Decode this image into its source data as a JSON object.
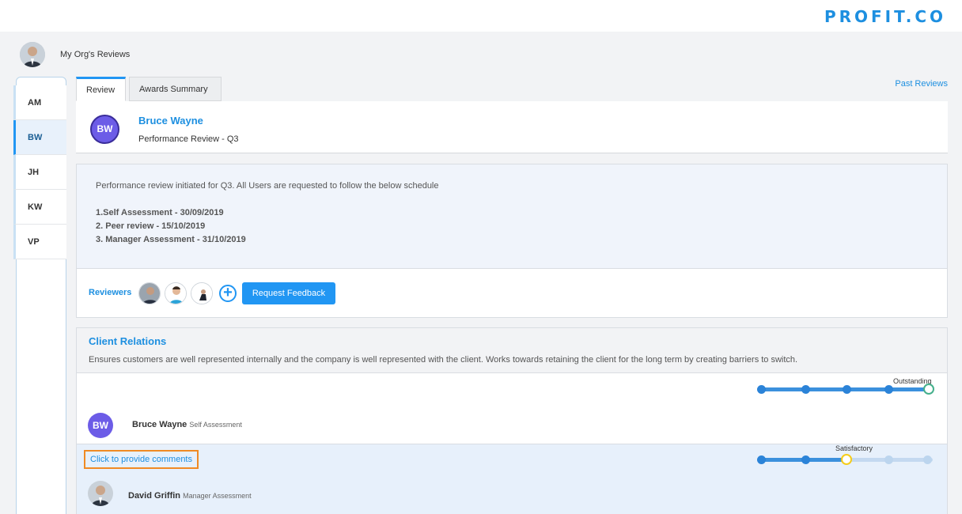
{
  "brand": {
    "name": "PROFIT.CO"
  },
  "org": {
    "title": "My Org's Reviews"
  },
  "sidebar": {
    "items": [
      {
        "label": "AM",
        "active": false
      },
      {
        "label": "BW",
        "active": true
      },
      {
        "label": "JH",
        "active": false
      },
      {
        "label": "KW",
        "active": false
      },
      {
        "label": "VP",
        "active": false
      }
    ]
  },
  "tabs": [
    {
      "label": "Review",
      "active": true
    },
    {
      "label": "Awards Summary",
      "active": false
    }
  ],
  "past_reviews_label": "Past Reviews",
  "person": {
    "initials": "BW",
    "name": "Bruce Wayne",
    "subtitle": "Performance Review - Q3"
  },
  "schedule": {
    "intro": "Performance review initiated for Q3. All Users are requested to follow the below schedule",
    "lines": [
      "1.Self Assessment - 30/09/2019",
      "2. Peer review - 15/10/2019",
      "3. Manager Assessment - 31/10/2019"
    ]
  },
  "reviewers": {
    "label": "Reviewers",
    "add_icon": "plus-circle-icon",
    "request_button": "Request Feedback"
  },
  "competency": {
    "title": "Client Relations",
    "description": "Ensures customers are well represented internally and the company is well represented with the client. Works towards retaining the client for the long term by creating barriers to switch.",
    "assessments": [
      {
        "reviewer_initials": "BW",
        "reviewer_name": "Bruce Wayne",
        "role": "Self Assessment",
        "rating_label": "Outstanding",
        "rating_level": 5,
        "scale_max": 5
      },
      {
        "reviewer_name": "David Griffin",
        "role": "Manager Assessment",
        "rating_label": "Satisfactory",
        "rating_level": 3,
        "scale_max": 5,
        "comment_link": "Click to provide comments"
      }
    ]
  },
  "colors": {
    "accent": "#2196f3",
    "avatar_purple": "#6c5ce7",
    "highlight_border": "#f08a24",
    "rating_selected_green": "#45b08c",
    "rating_selected_yellow": "#f5cc1a"
  }
}
